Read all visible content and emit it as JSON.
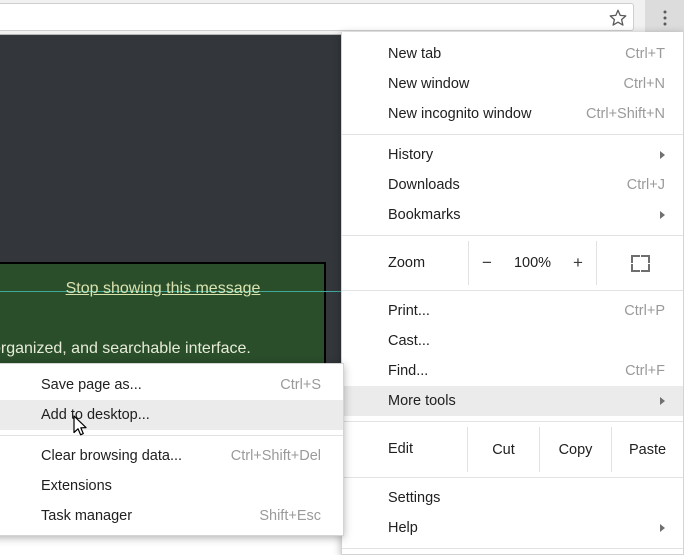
{
  "toolbar": {
    "omnibox_value": "",
    "omnibox_placeholder": "",
    "star_icon": "star-icon",
    "menu_icon": "three-dots-icon"
  },
  "page": {
    "stop_link": "Stop showing this message",
    "body_text": "organized, and searchable interface.",
    "colors": {
      "page_background": "#33373b",
      "panel_background": "#2a4d2a",
      "rule_line": "#3fa99a",
      "link_text": "#d9e3b0"
    }
  },
  "main_menu": {
    "groups": [
      {
        "items": [
          {
            "label": "New tab",
            "accel": "Ctrl+T",
            "arrow": false,
            "hover": false
          },
          {
            "label": "New window",
            "accel": "Ctrl+N",
            "arrow": false,
            "hover": false
          },
          {
            "label": "New incognito window",
            "accel": "Ctrl+Shift+N",
            "arrow": false,
            "hover": false
          }
        ]
      },
      {
        "items": [
          {
            "label": "History",
            "accel": "",
            "arrow": true,
            "hover": false
          },
          {
            "label": "Downloads",
            "accel": "Ctrl+J",
            "arrow": false,
            "hover": false
          },
          {
            "label": "Bookmarks",
            "accel": "",
            "arrow": true,
            "hover": false
          }
        ]
      }
    ],
    "zoom_row": {
      "label": "Zoom",
      "minus": "−",
      "value": "100%",
      "plus": "+",
      "fullscreen_icon": "fullscreen-icon"
    },
    "tools_group": [
      {
        "label": "Print...",
        "accel": "Ctrl+P",
        "arrow": false,
        "hover": false
      },
      {
        "label": "Cast...",
        "accel": "",
        "arrow": false,
        "hover": false
      },
      {
        "label": "Find...",
        "accel": "Ctrl+F",
        "arrow": false,
        "hover": false
      },
      {
        "label": "More tools",
        "accel": "",
        "arrow": true,
        "hover": true
      }
    ],
    "edit_row": {
      "label": "Edit",
      "buttons": [
        "Cut",
        "Copy",
        "Paste"
      ]
    },
    "footer_group": [
      {
        "label": "Settings",
        "accel": "",
        "arrow": false,
        "hover": false
      },
      {
        "label": "Help",
        "accel": "",
        "arrow": true,
        "hover": false
      }
    ]
  },
  "submenu": {
    "group_a": [
      {
        "label": "Save page as...",
        "accel": "Ctrl+S",
        "hover": false
      },
      {
        "label": "Add to desktop...",
        "accel": "",
        "hover": true
      }
    ],
    "group_b": [
      {
        "label": "Clear browsing data...",
        "accel": "Ctrl+Shift+Del",
        "hover": false
      },
      {
        "label": "Extensions",
        "accel": "",
        "hover": false
      },
      {
        "label": "Task manager",
        "accel": "Shift+Esc",
        "hover": false
      }
    ]
  },
  "cursor": {
    "icon": "mouse-pointer-icon"
  }
}
